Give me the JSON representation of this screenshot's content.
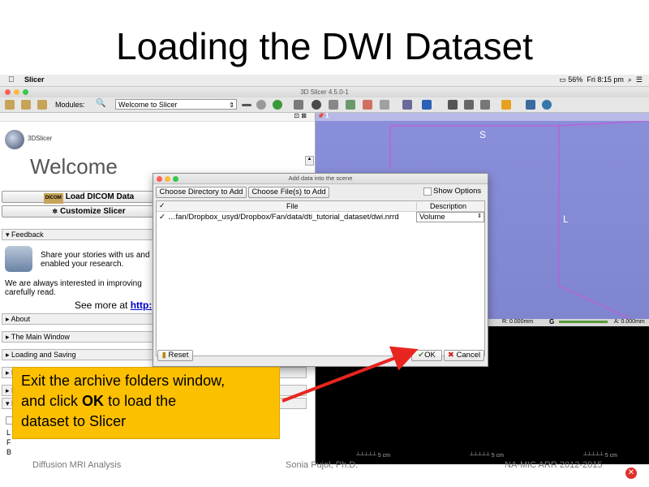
{
  "slide": {
    "title": "Loading the DWI Dataset",
    "footer_left": "Diffusion MRI Analysis",
    "footer_center": "Sonia Pujol, Ph.D.",
    "footer_right": "NA-MIC ARR 2012-2015"
  },
  "menubar": {
    "app_name": "Slicer",
    "battery": "56%",
    "clock": "Fri 8:15 pm"
  },
  "window": {
    "title": "3D Slicer 4.5.0-1"
  },
  "toolbar": {
    "modules_label": "Modules:",
    "module_selected": "Welcome to Slicer"
  },
  "left_panel": {
    "logo_text": "3DSlicer",
    "welcome": "Welcome",
    "load_dicom": "Load DICOM Data",
    "dicom_badge": "DICOM",
    "customize": "Customize Slicer",
    "feedback_header": "Feedback",
    "feedback_text1": "Share your stories with us and",
    "feedback_text2": "enabled your research.",
    "interest_text1": "We are always interested in improving",
    "interest_text2": "carefully read.",
    "see_more": "See more at",
    "see_more_link": "http:",
    "sections": [
      "About",
      "The Main Window",
      "Loading and Saving"
    ],
    "partial_letters": [
      "D",
      "M",
      "D"
    ],
    "small_letters": [
      "L",
      "F",
      "B"
    ]
  },
  "view3d": {
    "label_s": "S",
    "label_l": "L",
    "view_number": "1"
  },
  "slice_bar": {
    "r_value": "R: 0.000mm",
    "g_label": "G",
    "a_value": "A: 0.000mm"
  },
  "scale_labels": [
    "5 cm",
    "5 cm",
    "5 cm"
  ],
  "dialog": {
    "title": "Add data into the scene",
    "choose_dir": "Choose Directory to Add",
    "choose_files": "Choose File(s) to Add",
    "show_options": "Show Options",
    "col_file": "File",
    "col_description": "Description",
    "row_file": "…fan/Dropbox_usyd/Dropbox/Fan/data/dti_tutorial_dataset/dwi.nrrd",
    "row_description": "Volume",
    "reset": "Reset",
    "ok": "OK",
    "cancel": "Cancel"
  },
  "callout": {
    "line1": "Exit the archive folders window,",
    "line2_pre": "and click",
    "line2_bold": "OK",
    "line2_post": "to load the",
    "line3": "dataset to Slicer"
  },
  "colors": {
    "callout": "#fdc000",
    "arrow": "#e8251f",
    "view3d": "#8a8fda",
    "box_magenta": "#c25bd9"
  }
}
